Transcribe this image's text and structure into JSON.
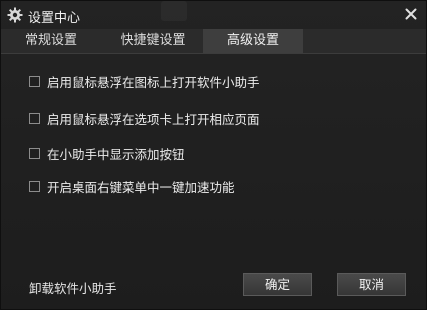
{
  "window": {
    "title": "设置中心",
    "icons": {
      "title": "gear-icon",
      "close": "close-icon"
    }
  },
  "tabs": [
    {
      "label": "常规设置",
      "active": false
    },
    {
      "label": "快捷键设置",
      "active": false
    },
    {
      "label": "高级设置",
      "active": true
    }
  ],
  "options": [
    {
      "label": "启用鼠标悬浮在图标上打开软件小助手",
      "checked": false
    },
    {
      "label": "启用鼠标悬浮在选项卡上打开相应页面",
      "checked": false
    },
    {
      "label": "在小助手中显示添加按钮",
      "checked": false
    },
    {
      "label": "开启桌面右键菜单中一键加速功能",
      "checked": false
    }
  ],
  "footer": {
    "uninstall_label": "卸载软件小助手",
    "ok_label": "确定",
    "cancel_label": "取消"
  },
  "colors": {
    "background": "#1f1f1f",
    "active_tab": "#3e3e3e"
  }
}
